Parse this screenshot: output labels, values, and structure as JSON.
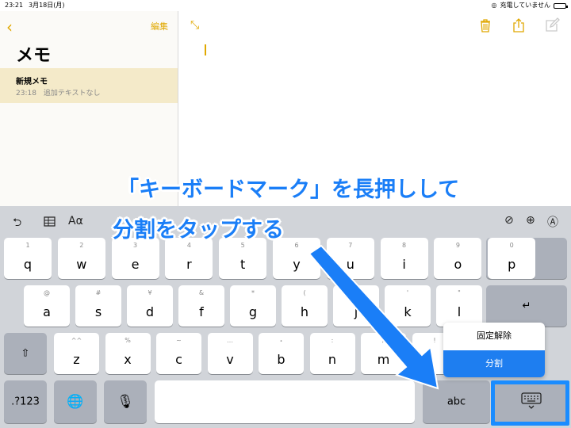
{
  "status_bar": {
    "time": "23:21",
    "date": "3月18日(月)",
    "charging": "充電していません"
  },
  "sidebar": {
    "title": "メモ",
    "edit_label": "編集",
    "back_icon": "chevron-left-icon",
    "notes": [
      {
        "title": "新規メモ",
        "time": "23:18",
        "preview": "追加テキストなし"
      }
    ]
  },
  "editor": {
    "toolbar_icons": [
      "expand-icon",
      "trash-icon",
      "share-icon",
      "compose-icon"
    ]
  },
  "keyboard": {
    "toolbar": {
      "format": "Aα",
      "icons": [
        "undo-icon",
        "table-icon",
        "checkmark-circle-icon",
        "plus-circle-icon",
        "markup-pen-icon"
      ]
    },
    "row1": [
      {
        "main": "q",
        "sub": "1"
      },
      {
        "main": "w",
        "sub": "2"
      },
      {
        "main": "e",
        "sub": "3"
      },
      {
        "main": "r",
        "sub": "4"
      },
      {
        "main": "t",
        "sub": "5"
      },
      {
        "main": "y",
        "sub": "6"
      },
      {
        "main": "u",
        "sub": "7"
      },
      {
        "main": "i",
        "sub": "8"
      },
      {
        "main": "o",
        "sub": "9"
      },
      {
        "main": "p",
        "sub": "0"
      }
    ],
    "row2": [
      {
        "main": "a",
        "sub": "@"
      },
      {
        "main": "s",
        "sub": "#"
      },
      {
        "main": "d",
        "sub": "¥"
      },
      {
        "main": "f",
        "sub": "&"
      },
      {
        "main": "g",
        "sub": "*"
      },
      {
        "main": "h",
        "sub": "("
      },
      {
        "main": "j",
        "sub": ")"
      },
      {
        "main": "k",
        "sub": "'"
      },
      {
        "main": "l",
        "sub": "\""
      }
    ],
    "row3": [
      {
        "main": "z",
        "sub": "^^"
      },
      {
        "main": "x",
        "sub": "%"
      },
      {
        "main": "c",
        "sub": "~"
      },
      {
        "main": "v",
        "sub": "…"
      },
      {
        "main": "b",
        "sub": "・"
      },
      {
        "main": "n",
        "sub": ":"
      },
      {
        "main": "m",
        "sub": "/"
      },
      {
        "main": "、",
        "sub": "!"
      }
    ],
    "num_label": ".?123",
    "abc_label": "abc",
    "popup": {
      "item1": "固定解除",
      "item2": "分割"
    }
  },
  "annotation": {
    "line1": "「キーボードマーク」を長押しして",
    "line2": "分割をタップする",
    "color": "#1a7ef7"
  }
}
